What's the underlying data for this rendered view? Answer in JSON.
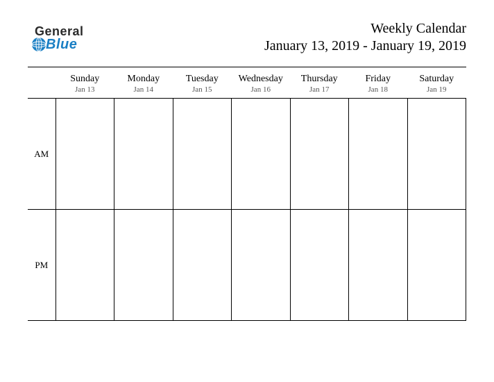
{
  "logo": {
    "general": "General",
    "blue": "Blue"
  },
  "header": {
    "title": "Weekly Calendar",
    "date_range": "January 13, 2019 - January 19, 2019"
  },
  "periods": {
    "am": "AM",
    "pm": "PM"
  },
  "days": [
    {
      "name": "Sunday",
      "date": "Jan 13"
    },
    {
      "name": "Monday",
      "date": "Jan 14"
    },
    {
      "name": "Tuesday",
      "date": "Jan 15"
    },
    {
      "name": "Wednesday",
      "date": "Jan 16"
    },
    {
      "name": "Thursday",
      "date": "Jan 17"
    },
    {
      "name": "Friday",
      "date": "Jan 18"
    },
    {
      "name": "Saturday",
      "date": "Jan 19"
    }
  ]
}
